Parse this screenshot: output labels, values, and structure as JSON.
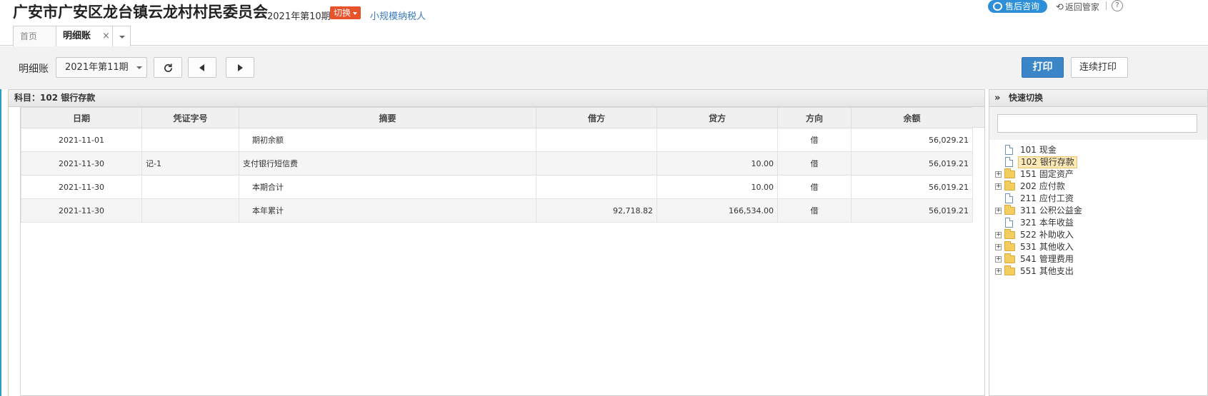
{
  "header": {
    "org_title": "广安市广安区龙台镇云龙村村民委员会",
    "period": "2021年第10期",
    "switch_label": "切换",
    "taxpayer_type": "小规模纳税人",
    "consult_label": "售后咨询",
    "return_label": "返回管家",
    "help_label": "?"
  },
  "tabs": {
    "home": "首页",
    "ledger": "明细账",
    "close_glyph": "×"
  },
  "toolbar": {
    "label": "明细账",
    "period_select": "2021年第11期",
    "print_label": "打印",
    "continuous_print_label": "连续打印"
  },
  "subject": {
    "label": "科目：102  银行存款"
  },
  "table": {
    "columns": [
      "日期",
      "凭证字号",
      "摘要",
      "借方",
      "贷方",
      "方向",
      "余额"
    ],
    "rows": [
      {
        "date": "2021-11-01",
        "voucher": "",
        "summary": "期初余额",
        "debit": "",
        "credit": "",
        "direction": "借",
        "balance": "56,029.21"
      },
      {
        "date": "2021-11-30",
        "voucher": "记-1",
        "summary": "支付银行短信费",
        "debit": "",
        "credit": "10.00",
        "direction": "借",
        "balance": "56,019.21"
      },
      {
        "date": "2021-11-30",
        "voucher": "",
        "summary": "本期合计",
        "debit": "",
        "credit": "10.00",
        "direction": "借",
        "balance": "56,019.21"
      },
      {
        "date": "2021-11-30",
        "voucher": "",
        "summary": "本年累计",
        "debit": "92,718.82",
        "credit": "166,534.00",
        "direction": "借",
        "balance": "56,019.21"
      }
    ]
  },
  "side": {
    "title": "快速切换",
    "collapse_glyph": "»",
    "search_placeholder": "",
    "tree": [
      {
        "code": "101",
        "name": "现金",
        "expandable": false,
        "selected": false
      },
      {
        "code": "102",
        "name": "银行存款",
        "expandable": false,
        "selected": true
      },
      {
        "code": "151",
        "name": "固定资产",
        "expandable": true,
        "selected": false
      },
      {
        "code": "202",
        "name": "应付款",
        "expandable": true,
        "selected": false
      },
      {
        "code": "211",
        "name": "应付工资",
        "expandable": false,
        "selected": false
      },
      {
        "code": "311",
        "name": "公积公益金",
        "expandable": true,
        "selected": false
      },
      {
        "code": "321",
        "name": "本年收益",
        "expandable": false,
        "selected": false
      },
      {
        "code": "522",
        "name": "补助收入",
        "expandable": true,
        "selected": false
      },
      {
        "code": "531",
        "name": "其他收入",
        "expandable": true,
        "selected": false
      },
      {
        "code": "541",
        "name": "管理费用",
        "expandable": true,
        "selected": false
      },
      {
        "code": "551",
        "name": "其他支出",
        "expandable": true,
        "selected": false
      }
    ]
  },
  "colors": {
    "accent": "#3b86c9",
    "switch": "#e8532b",
    "consult": "#2c8fd8",
    "link": "#3a7bbf",
    "selected_bg": "#fde9b6"
  }
}
